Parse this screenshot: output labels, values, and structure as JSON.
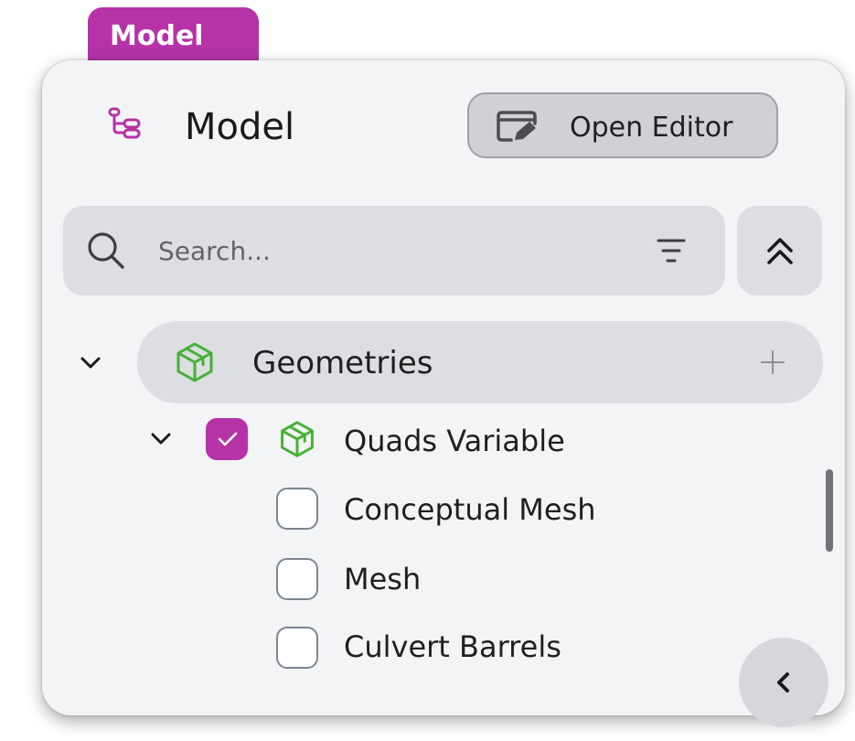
{
  "tab": {
    "label": "Model"
  },
  "header": {
    "title": "Model",
    "icon": "model-tree-icon",
    "open_editor_label": "Open Editor",
    "open_editor_icon": "editor-icon"
  },
  "search": {
    "placeholder": "Search...",
    "value": "",
    "icon": "search-icon",
    "filter_icon": "filter-icon"
  },
  "collapse_all_icon": "double-chevron-up-icon",
  "tree": {
    "group": {
      "label": "Geometries",
      "icon": "cube-icon",
      "add_icon": "plus-icon",
      "expanded": true
    },
    "item": {
      "label": "Quads Variable",
      "checked": true,
      "icon": "cube-icon",
      "expanded": true
    },
    "children": [
      {
        "label": "Conceptual Mesh",
        "checked": false
      },
      {
        "label": "Mesh",
        "checked": false
      },
      {
        "label": "Culvert Barrels",
        "checked": false
      }
    ]
  },
  "collapse_panel_icon": "chevron-left-icon",
  "colors": {
    "accent": "#b533a6",
    "cube_green": "#46b035",
    "panel_bg": "#f3f4f6",
    "control_bg": "#dcdee1"
  }
}
